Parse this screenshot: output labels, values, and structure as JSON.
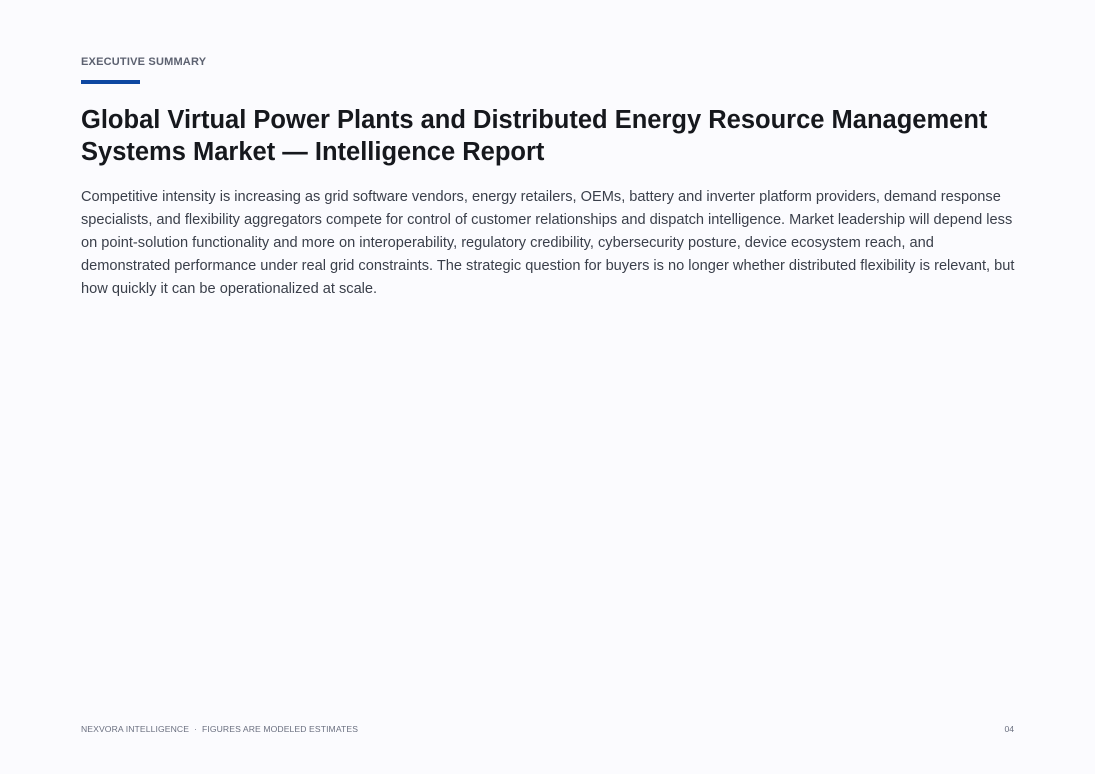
{
  "section": {
    "eyebrow": "EXECUTIVE SUMMARY",
    "accent_color": "#0d47a1"
  },
  "document": {
    "title": "Global Virtual Power Plants and Distributed Energy Resource Management Systems Market — Intelligence Report",
    "body": "Competitive intensity is increasing as grid software vendors, energy retailers, OEMs, battery and inverter platform providers, demand response specialists, and flexibility aggregators compete for control of customer relationships and dispatch intelligence. Market leadership will depend less on point-solution functionality and more on interoperability, regulatory credibility, cybersecurity posture, device ecosystem reach, and demonstrated performance under real grid constraints. The strategic question for buyers is no longer whether distributed flexibility is relevant, but how quickly it can be operationalized at scale."
  },
  "footer": {
    "brand": "NEXVORA INTELLIGENCE",
    "separator": "·",
    "note": "FIGURES ARE MODELED ESTIMATES",
    "page_number": "04"
  }
}
